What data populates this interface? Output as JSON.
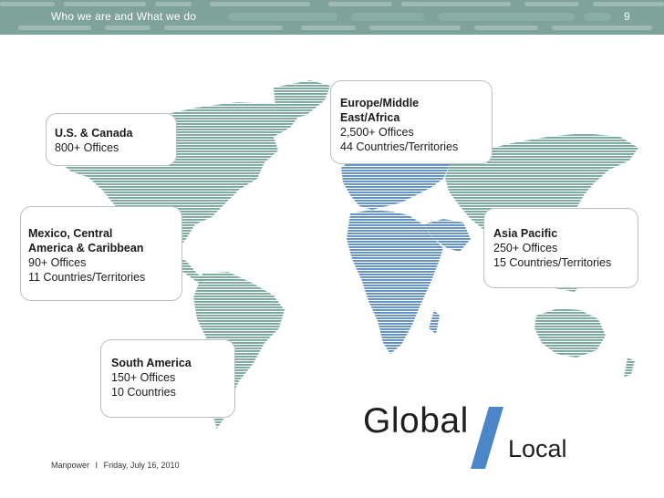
{
  "header": {
    "title": "Who we are and What we do",
    "page_number": "9"
  },
  "regions": {
    "us_canada": {
      "name": "U.S. & Canada",
      "offices": "800+ Offices"
    },
    "emea": {
      "name_line1": "Europe/Middle",
      "name_line2": "East/Africa",
      "offices": "2,500+ Offices",
      "countries": "44 Countries/Territories"
    },
    "mexico": {
      "name_line1": "Mexico, Central",
      "name_line2": "America & Caribbean",
      "offices": "90+ Offices",
      "countries": "11 Countries/Territories"
    },
    "asia_pacific": {
      "name": "Asia Pacific",
      "offices": "250+ Offices",
      "countries": "15 Countries/Territories"
    },
    "south_america": {
      "name": "South America",
      "offices": "150+ Offices",
      "countries": "10 Countries"
    }
  },
  "tagline": {
    "global": "Global",
    "local": "Local"
  },
  "footer": {
    "company": "Manpower",
    "separator": "I",
    "date": "Friday, July 16, 2010"
  },
  "colors": {
    "header_band": "#7fa39a",
    "map_green": "#7aa89c",
    "map_blue": "#5f8fc2",
    "slash_blue": "#4a86c8"
  }
}
